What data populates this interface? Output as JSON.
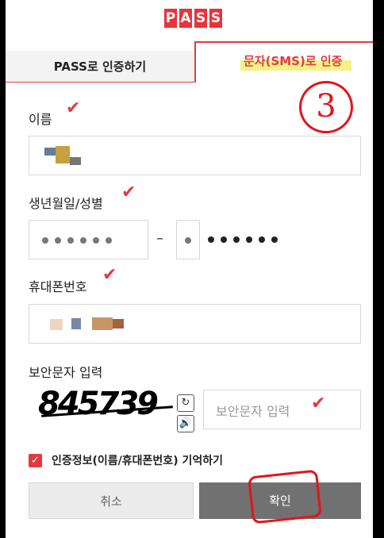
{
  "logo": {
    "letters": [
      "P",
      "A",
      "S",
      "S"
    ]
  },
  "tabs": [
    {
      "label": "PASS로 인증하기"
    },
    {
      "label": "문자(SMS)로 인증"
    }
  ],
  "annotation_number": "3",
  "form": {
    "name_label": "이름",
    "birth_label": "생년월일/성별",
    "phone_label": "휴대폰번호",
    "captcha_label": "보안문자 입력",
    "captcha_code": "845739",
    "captcha_placeholder": "보안문자 입력",
    "dash": "–"
  },
  "remember": {
    "label": "인증정보(이름/휴대폰번호) 기억하기"
  },
  "buttons": {
    "cancel": "취소",
    "confirm": "확인"
  },
  "icons": {
    "refresh": "refresh-icon",
    "audio": "speaker-icon",
    "check": "checkmark-icon"
  },
  "colors": {
    "accent": "#e43a3f",
    "confirm_bg": "#717171",
    "cancel_bg": "#ececec"
  }
}
